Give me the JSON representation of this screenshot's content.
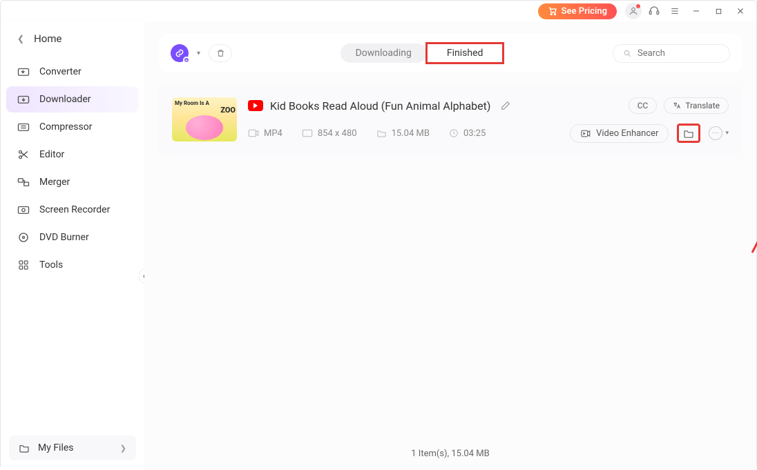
{
  "titlebar": {
    "see_pricing": "See Pricing"
  },
  "home": {
    "label": "Home"
  },
  "sidebar": {
    "items": [
      {
        "label": "Converter"
      },
      {
        "label": "Downloader"
      },
      {
        "label": "Compressor"
      },
      {
        "label": "Editor"
      },
      {
        "label": "Merger"
      },
      {
        "label": "Screen Recorder"
      },
      {
        "label": "DVD Burner"
      },
      {
        "label": "Tools"
      }
    ],
    "my_files": "My Files"
  },
  "tabs": {
    "downloading": "Downloading",
    "finished": "Finished"
  },
  "search": {
    "placeholder": "Search"
  },
  "item": {
    "title": "Kid Books Read Aloud  (Fun Animal Alphabet)",
    "cc": "CC",
    "translate": "Translate",
    "format": "MP4",
    "resolution": "854 x 480",
    "size": "15.04 MB",
    "duration": "03:25",
    "enhancer": "Video Enhancer",
    "thumb_line1": "My Room Is A",
    "thumb_line2": "ZOO"
  },
  "status": {
    "summary": "1 Item(s), 15.04 MB"
  }
}
